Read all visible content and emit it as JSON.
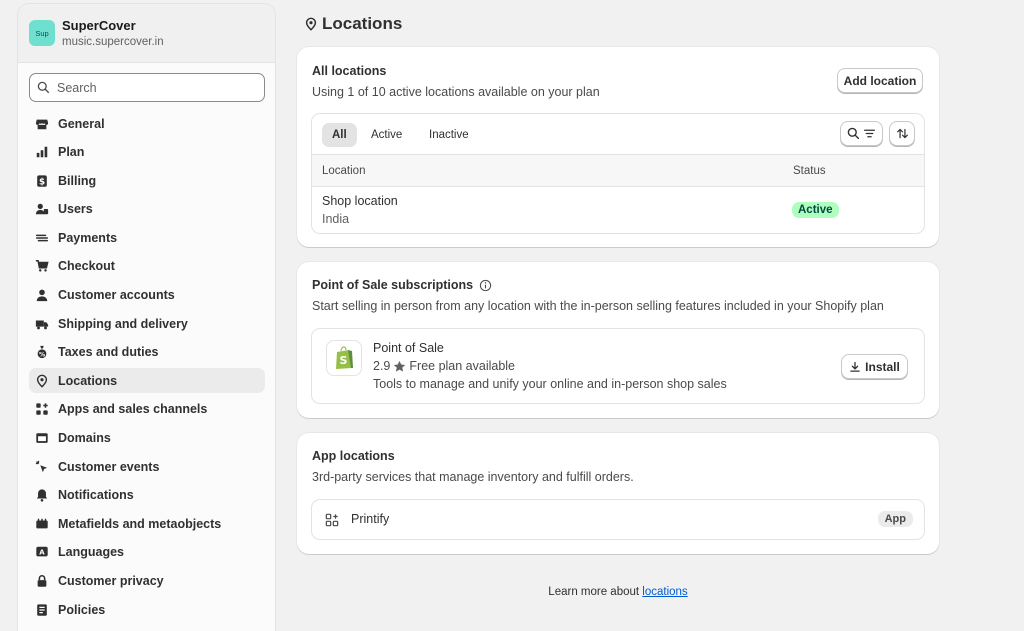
{
  "store": {
    "logo_text": "Sup",
    "name": "SuperCover",
    "domain": "music.supercover.in"
  },
  "search": {
    "placeholder": "Search"
  },
  "nav": [
    {
      "label": "General",
      "icon": "store-icon"
    },
    {
      "label": "Plan",
      "icon": "plan-icon"
    },
    {
      "label": "Billing",
      "icon": "billing-icon"
    },
    {
      "label": "Users",
      "icon": "users-icon"
    },
    {
      "label": "Payments",
      "icon": "payments-icon"
    },
    {
      "label": "Checkout",
      "icon": "cart-icon"
    },
    {
      "label": "Customer accounts",
      "icon": "person-icon"
    },
    {
      "label": "Shipping and delivery",
      "icon": "truck-icon"
    },
    {
      "label": "Taxes and duties",
      "icon": "tax-icon"
    },
    {
      "label": "Locations",
      "icon": "location-icon",
      "active": true
    },
    {
      "label": "Apps and sales channels",
      "icon": "apps-icon"
    },
    {
      "label": "Domains",
      "icon": "domains-icon"
    },
    {
      "label": "Customer events",
      "icon": "cursor-icon"
    },
    {
      "label": "Notifications",
      "icon": "bell-icon"
    },
    {
      "label": "Metafields and metaobjects",
      "icon": "metafields-icon"
    },
    {
      "label": "Languages",
      "icon": "language-icon"
    },
    {
      "label": "Customer privacy",
      "icon": "lock-icon"
    },
    {
      "label": "Policies",
      "icon": "policies-icon"
    }
  ],
  "page": {
    "title": "Locations"
  },
  "all_locations": {
    "title": "All locations",
    "subtitle": "Using 1 of 10 active locations available on your plan",
    "add_button": "Add location",
    "tabs": [
      "All",
      "Active",
      "Inactive"
    ],
    "columns": [
      "Location",
      "Status"
    ],
    "rows": [
      {
        "name": "Shop location",
        "country": "India",
        "status": "Active"
      }
    ]
  },
  "pos": {
    "title": "Point of Sale subscriptions",
    "subtitle": "Start selling in person from any location with the in-person selling features included in your Shopify plan",
    "app_name": "Point of Sale",
    "rating": "2.9",
    "plan": "Free plan available",
    "description": "Tools to manage and unify your online and in-person shop sales",
    "install_button": "Install"
  },
  "app_locations": {
    "title": "App locations",
    "subtitle": "3rd-party services that manage inventory and fulfill orders.",
    "app_name": "Printify",
    "badge": "App"
  },
  "footer": {
    "text": "Learn more about",
    "link": "locations"
  },
  "colors": {
    "active_badge_bg": "#affebf",
    "active_badge_text": "#014b40",
    "link": "#005bd3",
    "logo_bg": "#6fe0cf",
    "shopify_green": "#95bf47"
  }
}
